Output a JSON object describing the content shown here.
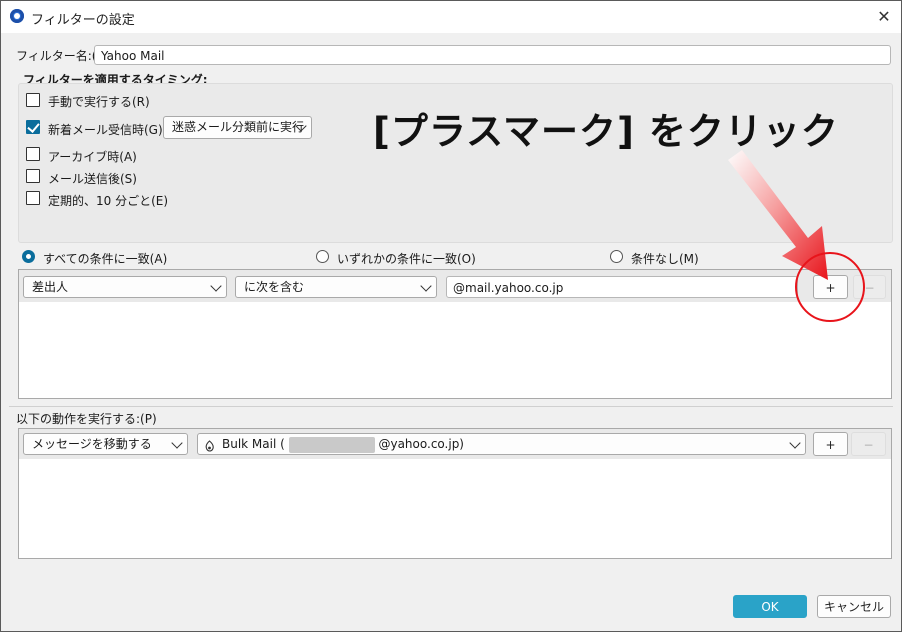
{
  "window": {
    "title": "フィルターの設定",
    "close_glyph": "✕"
  },
  "filter_name": {
    "label": "フィルター名:(I)",
    "value": "Yahoo Mail"
  },
  "timing": {
    "heading": "フィルターを適用するタイミング:",
    "options": [
      {
        "label": "手動で実行する(R)",
        "checked": false
      },
      {
        "label": "新着メール受信時(G):",
        "checked": true
      },
      {
        "label": "アーカイブ時(A)",
        "checked": false
      },
      {
        "label": "メール送信後(S)",
        "checked": false
      },
      {
        "label": "定期的、10 分ごと(E)",
        "checked": false
      }
    ],
    "new_mail_select": "迷惑メール分類前に実行"
  },
  "match": {
    "options": [
      {
        "label": "すべての条件に一致(A)",
        "selected": true
      },
      {
        "label": "いずれかの条件に一致(O)",
        "selected": false
      },
      {
        "label": "条件なし(M)",
        "selected": false
      }
    ]
  },
  "rule": {
    "field": "差出人",
    "operator": "に次を含む",
    "value": "@mail.yahoo.co.jp",
    "add_label": "+",
    "remove_label": "−"
  },
  "actions": {
    "heading": "以下の動作を実行する:(P)",
    "action": "メッセージを移動する",
    "target_prefix": "Bulk Mail (",
    "target_suffix": "@yahoo.co.jp)",
    "add_label": "+",
    "remove_label": "−"
  },
  "footer": {
    "ok_label": "OK",
    "cancel_label": "キャンセル"
  },
  "annotation": {
    "text": "[プラスマーク] をクリック",
    "color": "#e8141b"
  }
}
